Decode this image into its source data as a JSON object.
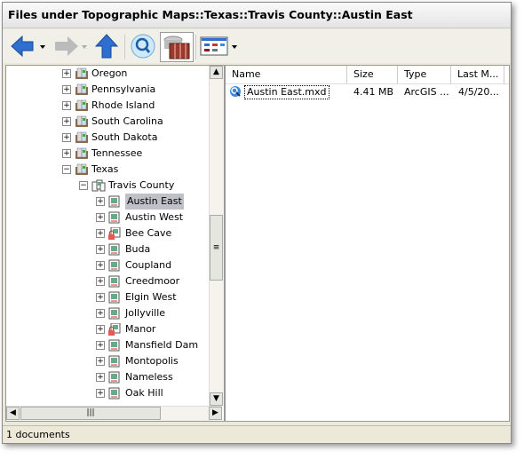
{
  "window": {
    "title": "Files under Topographic Maps::Texas::Travis County::Austin East"
  },
  "toolbar": {
    "icons": [
      "back-arrow-icon",
      "forward-arrow-icon",
      "up-arrow-icon",
      "search-icon",
      "catalog-icon",
      "view-options-icon"
    ]
  },
  "tree": {
    "states": [
      "Oregon",
      "Pennsylvania",
      "Rhode Island",
      "South Carolina",
      "South Dakota",
      "Tennessee",
      "Texas"
    ],
    "county": "Travis County",
    "quads": [
      {
        "label": "Austin East",
        "selected": true,
        "locked": false
      },
      {
        "label": "Austin West",
        "locked": false
      },
      {
        "label": "Bee Cave",
        "locked": true
      },
      {
        "label": "Buda",
        "locked": false
      },
      {
        "label": "Coupland",
        "locked": false
      },
      {
        "label": "Creedmoor",
        "locked": false
      },
      {
        "label": "Elgin West",
        "locked": false
      },
      {
        "label": "Jollyville",
        "locked": false
      },
      {
        "label": "Manor",
        "locked": true
      },
      {
        "label": "Mansfield Dam",
        "locked": false
      },
      {
        "label": "Montopolis",
        "locked": false
      },
      {
        "label": "Nameless",
        "locked": false
      },
      {
        "label": "Oak Hill",
        "locked": false
      }
    ]
  },
  "list": {
    "columns": [
      "Name",
      "Size",
      "Type",
      "Last M..."
    ],
    "rows": [
      {
        "name": "Austin East.mxd",
        "size": "4.41 MB",
        "type": "ArcGIS ...",
        "modified": "4/5/20..."
      }
    ]
  },
  "status": "1 documents"
}
